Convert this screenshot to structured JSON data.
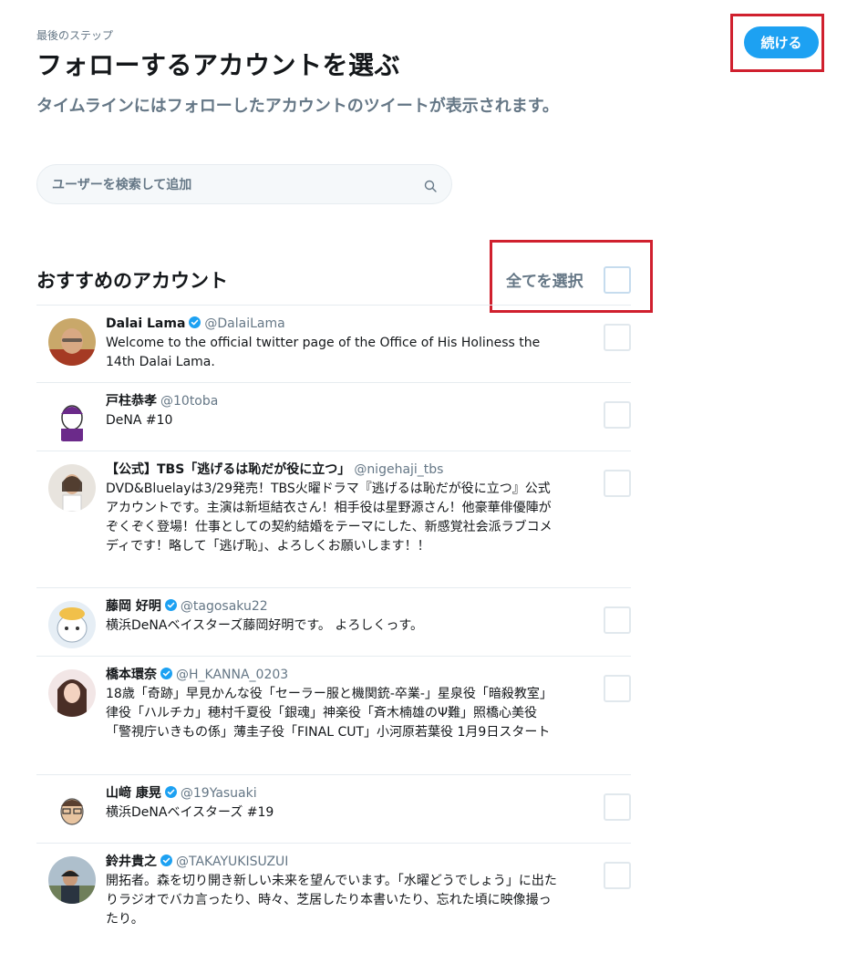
{
  "header": {
    "step_label": "最後のステップ",
    "title": "フォローするアカウントを選ぶ",
    "subtitle": "タイムラインにはフォローしたアカウントのツイートが表示されます。",
    "continue_label": "続ける"
  },
  "search": {
    "placeholder": "ユーザーを検索して追加",
    "value": ""
  },
  "recommendations": {
    "title": "おすすめのアカウント",
    "select_all_label": "全てを選択",
    "select_all_checked": false
  },
  "accounts": [
    {
      "display_name": "Dalai Lama",
      "verified": true,
      "screen_name": "@DalaiLama",
      "bio": "Welcome to the official twitter page of the Office of His Holiness the 14th Dalai Lama.",
      "checked": false
    },
    {
      "display_name": "戸柱恭孝",
      "verified": false,
      "screen_name": "@10toba",
      "bio": "DeNA #10",
      "checked": false
    },
    {
      "display_name": "【公式】TBS「逃げるは恥だが役に立つ」",
      "verified": false,
      "screen_name": "@nigehaji_tbs",
      "bio": "DVD&Bluelayは3/29発売！TBS火曜ドラマ『逃げるは恥だが役に立つ』公式アカウントです。主演は新垣結衣さん！相手役は星野源さん！他豪華俳優陣がぞくぞく登場！仕事としての契約結婚をテーマにした、新感覚社会派ラブコメディです！略して「逃げ恥」、よろしくお願いします！！",
      "checked": false
    },
    {
      "display_name": "藤岡 好明",
      "verified": true,
      "screen_name": "@tagosaku22",
      "bio": "横浜DeNAベイスターズ藤岡好明です。 よろしくっす。",
      "checked": false
    },
    {
      "display_name": "橋本環奈",
      "verified": true,
      "screen_name": "@H_KANNA_0203",
      "bio": "18歳「奇跡」早見かんな役「セーラー服と機関銃-卒業-」星泉役「暗殺教室」律役「ハルチカ」穂村千夏役「銀魂」神楽役「斉木楠雄のΨ難」照橋心美役「警視庁いきもの係」薄圭子役「FINAL CUT」小河原若葉役 1月9日スタート",
      "checked": false
    },
    {
      "display_name": "山﨑 康晃",
      "verified": true,
      "screen_name": "@19Yasuaki",
      "bio": "横浜DeNAベイスターズ #19",
      "checked": false
    },
    {
      "display_name": "鈴井貴之",
      "verified": true,
      "screen_name": "@TAKAYUKISUZUI",
      "bio": "開拓者。森を切り開き新しい未来を望んでいます。「水曜どうでしょう」に出たりラジオでバカ言ったり、時々、芝居したり本書いたり、忘れた頃に映像撮ったり。",
      "checked": false
    }
  ],
  "colors": {
    "accent": "#1da1f2",
    "highlight": "#d0202e",
    "secondary_text": "#657786"
  }
}
